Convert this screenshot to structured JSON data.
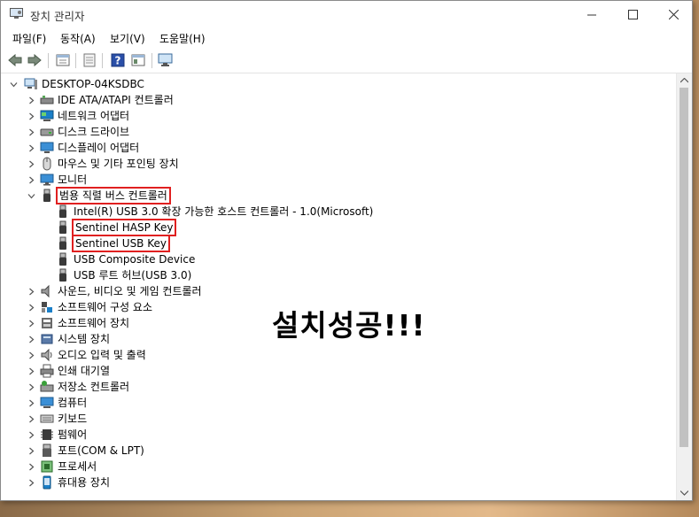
{
  "window": {
    "title": "장치 관리자"
  },
  "menus": [
    "파일(F)",
    "동작(A)",
    "보기(V)",
    "도움말(H)"
  ],
  "toolbar": {
    "icons": [
      "back-icon",
      "forward-icon",
      "properties-icon",
      "help-icon",
      "view-icon",
      "monitor-icon"
    ]
  },
  "tree": {
    "root": "DESKTOP-04KSDBC",
    "categories_top": [
      "IDE ATA/ATAPI 컨트롤러",
      "네트워크 어댑터",
      "디스크 드라이브",
      "디스플레이 어댑터",
      "마우스 및 기타 포인팅 장치",
      "모니터"
    ],
    "expanded": {
      "label": "범용 직렬 버스 컨트롤러",
      "children": [
        "Intel(R) USB 3.0 확장 가능한 호스트 컨트롤러 - 1.0(Microsoft)",
        "Sentinel HASP Key",
        "Sentinel USB Key",
        "USB Composite Device",
        "USB 루트 허브(USB 3.0)"
      ]
    },
    "categories_bottom": [
      "사운드, 비디오 및 게임 컨트롤러",
      "소프트웨어 구성 요소",
      "소프트웨어 장치",
      "시스템 장치",
      "오디오 입력 및 출력",
      "인쇄 대기열",
      "저장소 컨트롤러",
      "컴퓨터",
      "키보드",
      "펌웨어",
      "포트(COM & LPT)",
      "프로세서",
      "휴대용 장치"
    ]
  },
  "annotation": "설치성공!!!",
  "colors": {
    "highlight_box": "#e02020",
    "accent": "#1a73c7"
  }
}
